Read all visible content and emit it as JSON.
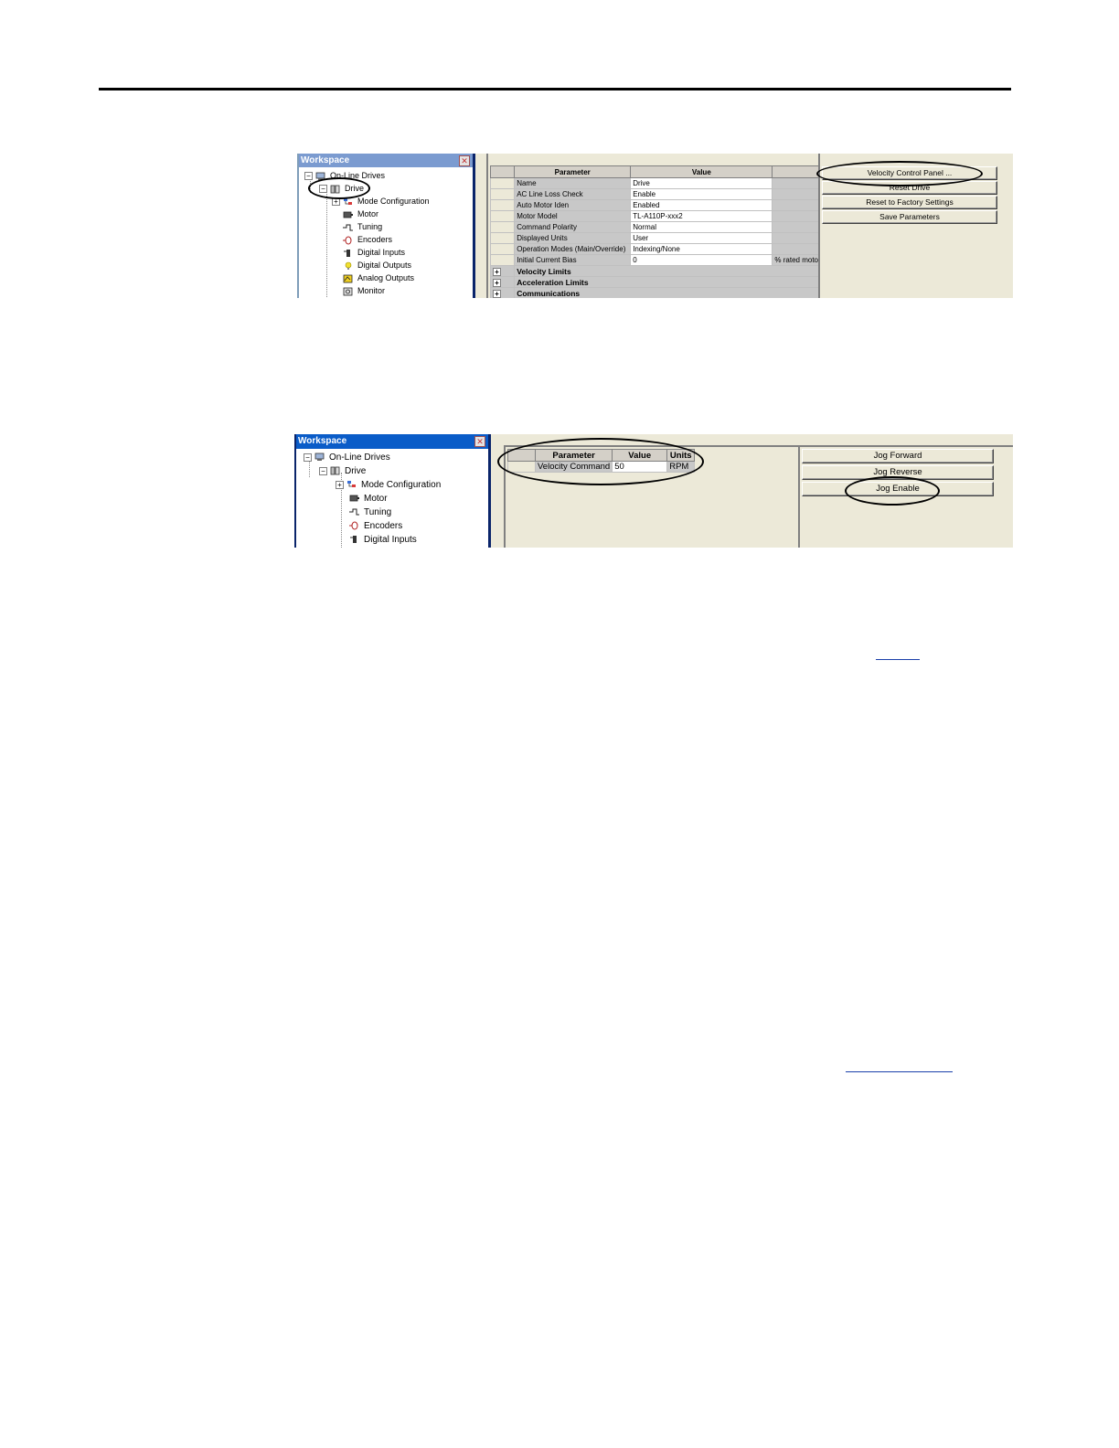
{
  "screenshot1": {
    "workspace": {
      "title": "Workspace",
      "tree": [
        {
          "label": "On-Line Drives",
          "icon": "network-icon"
        },
        {
          "label": "Drive",
          "icon": "drive-icon"
        },
        {
          "label": "Mode Configuration",
          "icon": "mode-icon"
        },
        {
          "label": "Motor",
          "icon": "motor-icon"
        },
        {
          "label": "Tuning",
          "icon": "tuning-icon"
        },
        {
          "label": "Encoders",
          "icon": "encoder-icon"
        },
        {
          "label": "Digital Inputs",
          "icon": "input-icon"
        },
        {
          "label": "Digital Outputs",
          "icon": "bulb-icon"
        },
        {
          "label": "Analog Outputs",
          "icon": "analog-icon"
        },
        {
          "label": "Monitor",
          "icon": "monitor-icon"
        }
      ]
    },
    "grid": {
      "headers": [
        "Parameter",
        "Value",
        "Un"
      ],
      "rows": [
        {
          "param": "Name",
          "value": "Drive",
          "units": ""
        },
        {
          "param": "AC Line Loss Check",
          "value": "Enable",
          "units": ""
        },
        {
          "param": "Auto Motor Iden",
          "value": "Enabled",
          "units": ""
        },
        {
          "param": "Motor Model",
          "value": "TL-A110P-xxx2",
          "units": ""
        },
        {
          "param": "Command Polarity",
          "value": "Normal",
          "units": ""
        },
        {
          "param": "Displayed Units",
          "value": "User",
          "units": ""
        },
        {
          "param": "Operation Modes (Main/Override)",
          "value": "Indexing/None",
          "units": ""
        },
        {
          "param": "Initial Current Bias",
          "value": "0",
          "units": "% rated moto"
        }
      ],
      "groups": [
        "Velocity Limits",
        "Acceleration Limits",
        "Communications"
      ]
    },
    "buttons": [
      "Velocity Control Panel ...",
      "Reset Drive",
      "Reset to Factory Settings",
      "Save Parameters"
    ]
  },
  "screenshot2": {
    "workspace": {
      "title": "Workspace",
      "tree": [
        {
          "label": "On-Line Drives",
          "icon": "network-icon"
        },
        {
          "label": "Drive",
          "icon": "drive-icon"
        },
        {
          "label": "Mode Configuration",
          "icon": "mode-icon"
        },
        {
          "label": "Motor",
          "icon": "motor-icon"
        },
        {
          "label": "Tuning",
          "icon": "tuning-icon"
        },
        {
          "label": "Encoders",
          "icon": "encoder-icon"
        },
        {
          "label": "Digital Inputs",
          "icon": "input-icon"
        }
      ]
    },
    "grid": {
      "headers": [
        "Parameter",
        "Value",
        "Units"
      ],
      "rows": [
        {
          "param": "Velocity Command",
          "value": "50",
          "units": "RPM"
        }
      ]
    },
    "buttons": [
      "Jog Forward",
      "Jog Reverse",
      "Jog Enable"
    ]
  }
}
